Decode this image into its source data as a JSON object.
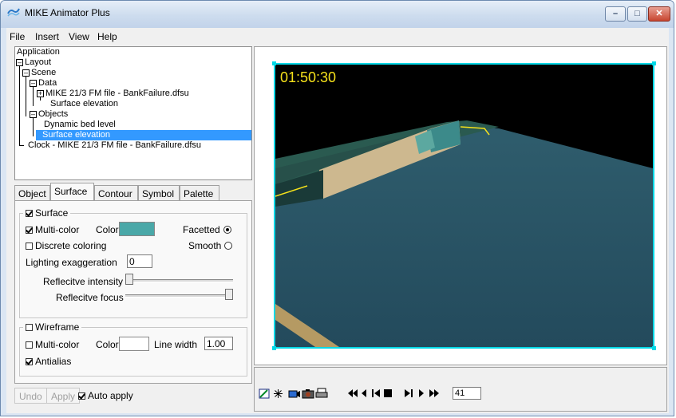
{
  "window": {
    "title": "MIKE Animator Plus",
    "controls": [
      "minimize",
      "maximize",
      "close"
    ]
  },
  "menu": [
    "File",
    "Insert",
    "View",
    "Help"
  ],
  "tree": {
    "items": [
      "Application",
      "Layout",
      "Scene",
      "Data",
      "MIKE 21/3 FM file - BankFailure.dfsu",
      "Surface elevation",
      "Objects",
      "Dynamic bed level",
      "Surface elevation",
      "Clock - MIKE 21/3 FM file - BankFailure.dfsu"
    ],
    "selected_index": 8
  },
  "tabs": [
    "Object",
    "Surface",
    "Contour",
    "Symbol",
    "Palette"
  ],
  "active_tab": "Surface",
  "surface": {
    "group_label": "Surface",
    "group_checked": true,
    "multicolor_label": "Multi-color",
    "multicolor_checked": true,
    "color_label": "Color",
    "color_value": "#4aa8a8",
    "facetted_label": "Facetted",
    "smooth_label": "Smooth",
    "shading": "Facetted",
    "discrete_label": "Discrete coloring",
    "discrete_checked": false,
    "lighting_label": "Lighting exaggeration",
    "lighting_value": "0",
    "reflective_intensity_label": "Reflecitve intensity",
    "reflective_intensity_level": 0.0,
    "reflective_focus_label": "Reflecitve focus",
    "reflective_focus_level": 1.0
  },
  "wireframe": {
    "group_label": "Wireframe",
    "group_checked": false,
    "multicolor_label": "Multi-color",
    "multicolor_checked": false,
    "color_label": "Color",
    "color_value": "#ffffff",
    "linewidth_label": "Line width",
    "linewidth_value": "1.00",
    "antialias_label": "Antialias",
    "antialias_checked": true
  },
  "actions": {
    "undo": "Undo",
    "apply": "Apply",
    "auto_apply": "Auto apply",
    "auto_apply_checked": true
  },
  "viewport": {
    "timecode": "01:50:30",
    "frame_color": "#00d8e6",
    "timecode_color": "#f5e11b"
  },
  "player": {
    "buttons": [
      "settings-icon",
      "snap-icon",
      "record-icon",
      "camera-icon",
      "print-icon",
      "rewind-icon",
      "step-back-icon",
      "first-frame-icon",
      "stop-icon",
      "last-frame-icon",
      "step-forward-icon",
      "fast-forward-icon"
    ],
    "frame": "41"
  }
}
